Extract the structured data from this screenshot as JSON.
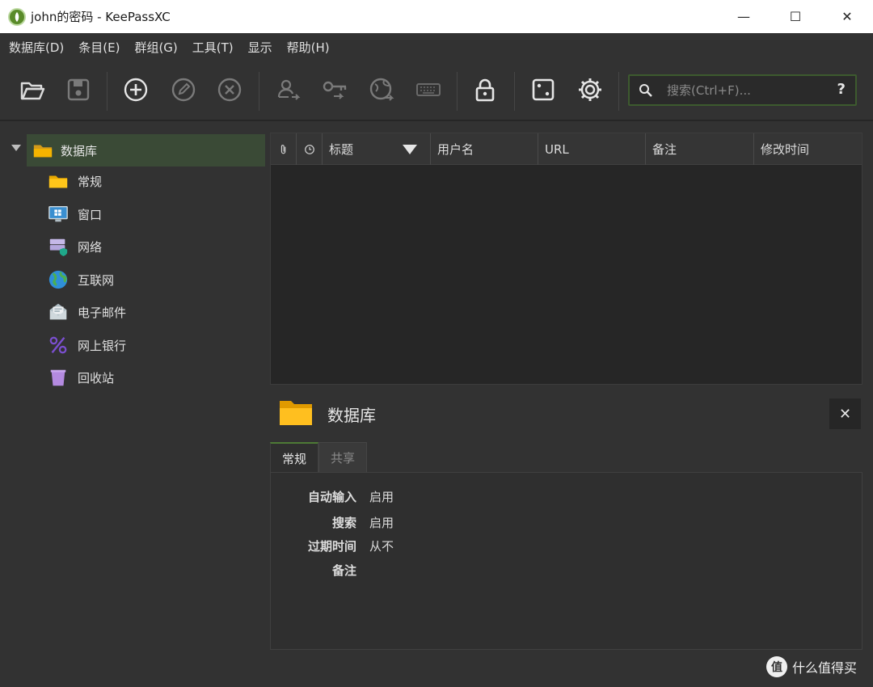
{
  "window": {
    "title": "john的密码 - KeePassXC",
    "minimize": "—",
    "maximize": "☐",
    "close": "✕"
  },
  "menu": [
    "数据库(D)",
    "条目(E)",
    "群组(G)",
    "工具(T)",
    "显示",
    "帮助(H)"
  ],
  "toolbar": {
    "icons": [
      "open-database-icon",
      "save-database-icon",
      "add-entry-icon",
      "edit-entry-icon",
      "delete-entry-icon",
      "copy-username-icon",
      "copy-password-icon",
      "copy-url-icon",
      "autotype-icon",
      "lock-database-icon",
      "password-generator-icon",
      "settings-icon"
    ],
    "search_placeholder": "搜索(Ctrl+F)...",
    "help": "?"
  },
  "tree": {
    "root": "数据库",
    "groups": [
      "常规",
      "窗口",
      "网络",
      "互联网",
      "电子邮件",
      "网上银行",
      "回收站"
    ],
    "group_icons": [
      "folder-icon",
      "windows-icon",
      "server-icon",
      "globe-icon",
      "email-icon",
      "percent-icon",
      "trash-icon"
    ]
  },
  "table": {
    "columns": [
      "标题",
      "用户名",
      "URL",
      "备注",
      "修改时间"
    ]
  },
  "preview": {
    "title": "数据库",
    "close": "✕",
    "tabs": [
      "常规",
      "共享"
    ],
    "properties": [
      {
        "key": "自动输入",
        "value": "启用"
      },
      {
        "key": "搜索",
        "value": "启用"
      },
      {
        "key": "过期时间",
        "value": "从不"
      },
      {
        "key": "备注",
        "value": ""
      }
    ]
  },
  "watermark": {
    "badge": "值",
    "text": "什么值得买"
  },
  "colors": {
    "accent": "#4d7a35",
    "folder": "#f5b400",
    "background": "#323232"
  }
}
